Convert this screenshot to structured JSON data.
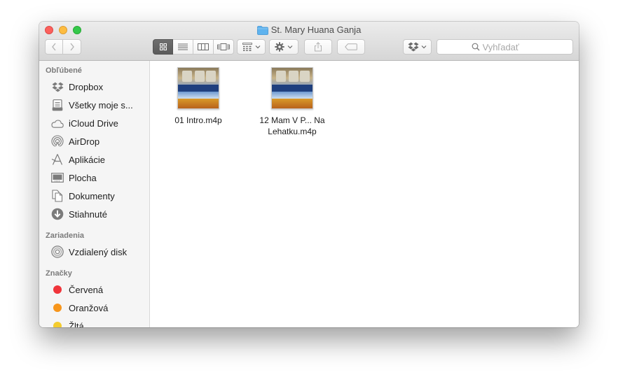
{
  "window": {
    "title": "St. Mary Huana Ganja"
  },
  "toolbar": {
    "search_placeholder": "Vyhľadať"
  },
  "sidebar": {
    "favorites_heading": "Obľúbené",
    "favorites": [
      {
        "label": "Dropbox",
        "icon": "dropbox-icon"
      },
      {
        "label": "Všetky moje s...",
        "icon": "all-files-icon"
      },
      {
        "label": "iCloud Drive",
        "icon": "icloud-icon"
      },
      {
        "label": "AirDrop",
        "icon": "airdrop-icon"
      },
      {
        "label": "Aplikácie",
        "icon": "applications-icon"
      },
      {
        "label": "Plocha",
        "icon": "desktop-icon"
      },
      {
        "label": "Dokumenty",
        "icon": "documents-icon"
      },
      {
        "label": "Stiahnuté",
        "icon": "downloads-icon"
      }
    ],
    "devices_heading": "Zariadenia",
    "devices": [
      {
        "label": "Vzdialený disk",
        "icon": "remote-disc-icon"
      }
    ],
    "tags_heading": "Značky",
    "tags": [
      {
        "label": "Červená",
        "color": "#f0353b"
      },
      {
        "label": "Oranžová",
        "color": "#f7961c"
      },
      {
        "label": "Žltá",
        "color": "#f4cc2e"
      }
    ]
  },
  "files": [
    {
      "name_line1": "01 Intro.m4p",
      "name_line2": ""
    },
    {
      "name_line1": "12 Mam V P... Na",
      "name_line2": "Lehatku.m4p"
    }
  ],
  "colors": {
    "folder": "#5fb3ee",
    "toolbar_active": "#646464"
  }
}
